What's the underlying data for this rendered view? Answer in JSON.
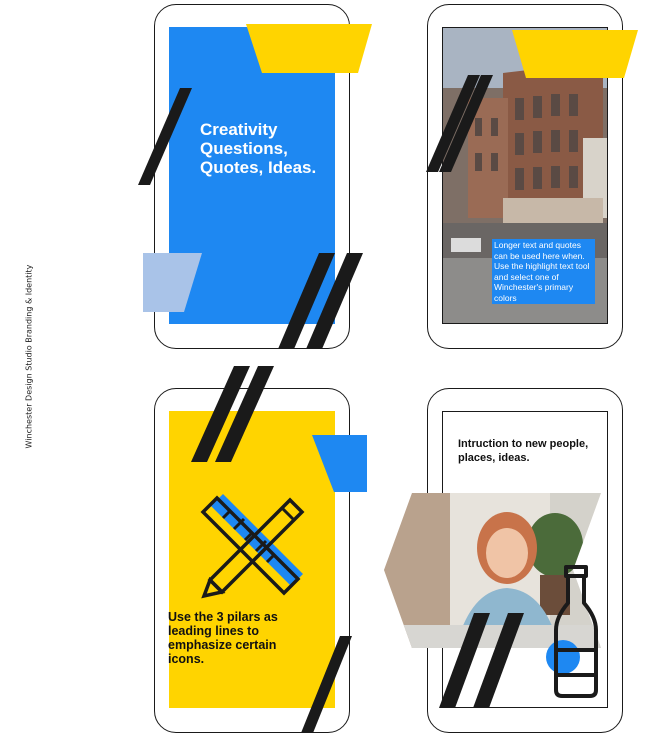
{
  "side_caption": "Winchester Design Studio Branding & Identity",
  "cards": [
    {
      "text": "Creativity Questions, Quotes, Ideas.",
      "background": "#1e88f2"
    },
    {
      "text": "Longer text and quotes can be used here when. Use the highlight text tool and select one of Winchester's primary colors",
      "image": "street-building-photo"
    },
    {
      "text": "Use the 3 pilars as leading lines to emphasize certain icons.",
      "background": "#ffd400",
      "icon": "ruler-pencil-icon"
    },
    {
      "text": "Intruction to new people, places, ideas.",
      "image": "smiling-person-photo",
      "icon": "bottle-icon"
    }
  ],
  "colors": {
    "blue": "#1e88f2",
    "yellow": "#ffd400",
    "black": "#1a1a1a",
    "light_blue": "#a9c3e8"
  }
}
